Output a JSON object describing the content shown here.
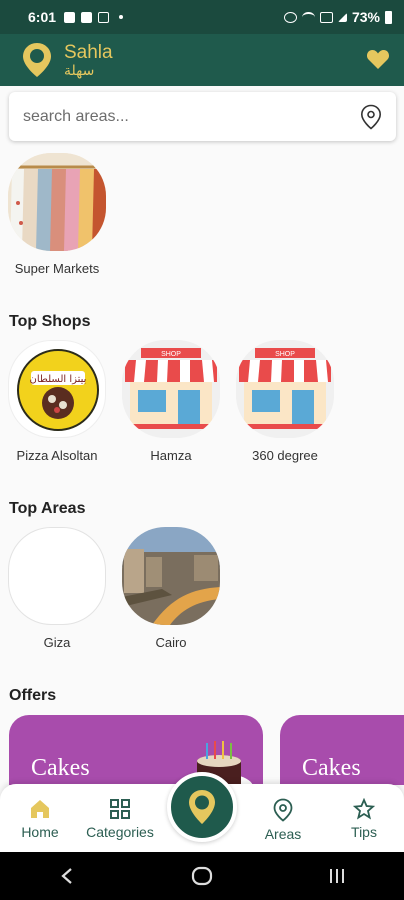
{
  "status": {
    "time": "6:01",
    "battery": "73%"
  },
  "app": {
    "name": "Sahla",
    "name_ar": "سهلة"
  },
  "search": {
    "placeholder": "search areas..."
  },
  "categories": [
    {
      "label": "Super Markets"
    }
  ],
  "top_shops": {
    "title": "Top Shops",
    "items": [
      {
        "label": "Pizza Alsoltan",
        "logo_text": "بيتزا السلطان"
      },
      {
        "label": "Hamza",
        "sign": "SHOP"
      },
      {
        "label": "360 degree",
        "sign": "SHOP"
      }
    ]
  },
  "top_areas": {
    "title": "Top Areas",
    "items": [
      {
        "label": "Giza"
      },
      {
        "label": "Cairo"
      }
    ]
  },
  "offers": {
    "title": "Offers",
    "items": [
      {
        "text": "Cakes"
      },
      {
        "text": "Cakes"
      }
    ]
  },
  "bottom_nav": {
    "home": "Home",
    "categories": "Categories",
    "areas": "Areas",
    "tips": "Tips"
  },
  "colors": {
    "primary": "#1f5a4c",
    "accent": "#e5c75e",
    "offer": "#a84cac"
  }
}
